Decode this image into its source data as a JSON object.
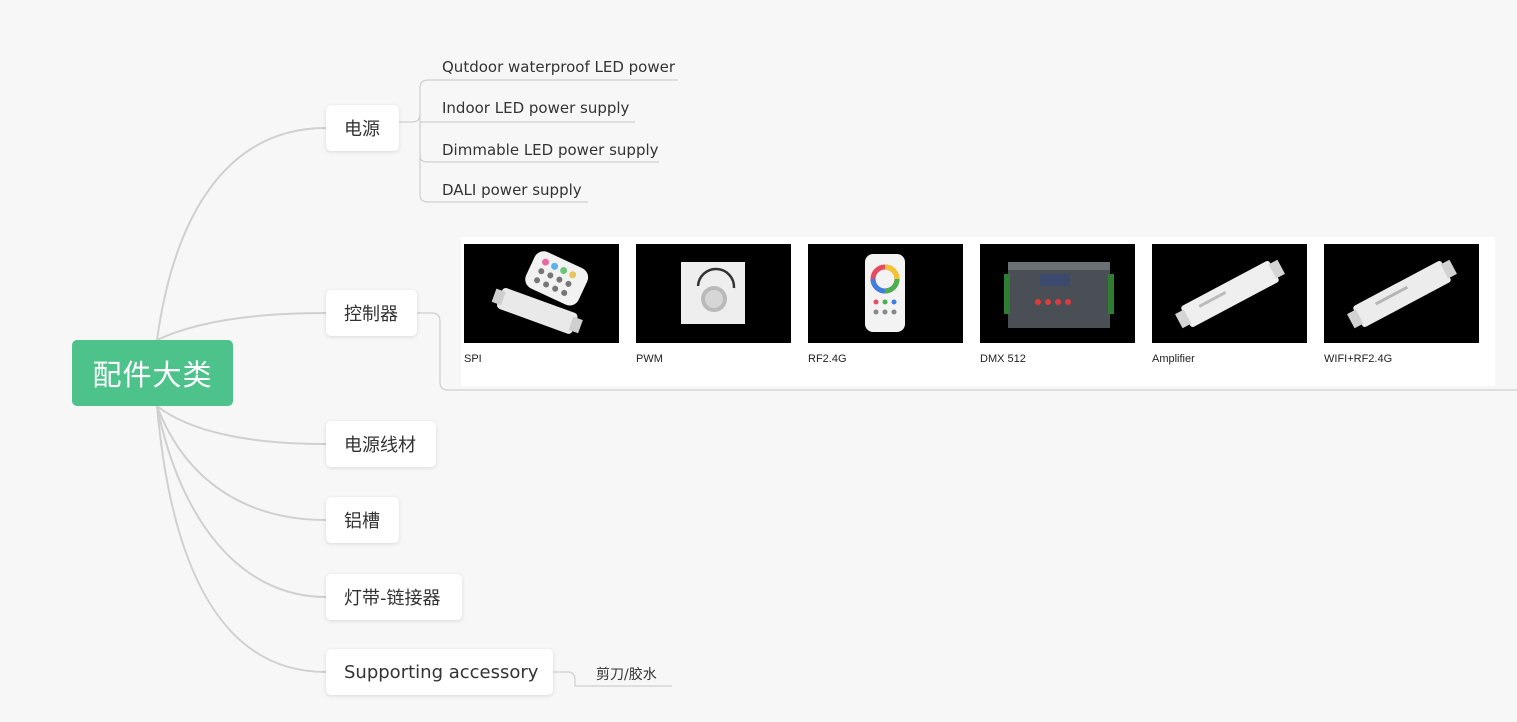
{
  "root": {
    "label": "配件大类"
  },
  "branches": [
    {
      "label": "电源"
    },
    {
      "label": "控制器"
    },
    {
      "label": "电源线材"
    },
    {
      "label": "铝槽"
    },
    {
      "label": "灯带-链接器"
    },
    {
      "label": "Supporting accessory"
    }
  ],
  "power_supply_items": [
    "Qutdoor waterproof LED power",
    "Indoor LED power supply",
    "Dimmable LED power supply",
    "DALI power supply"
  ],
  "controller_gallery": [
    {
      "label": "SPI",
      "image": "rf-remote-with-controller"
    },
    {
      "label": "PWM",
      "image": "rotary-dimmer-panel"
    },
    {
      "label": "RF2.4G",
      "image": "color-wheel-remote"
    },
    {
      "label": "DMX 512",
      "image": "dmx-controller-box"
    },
    {
      "label": "Amplifier",
      "image": "amplifier-module"
    },
    {
      "label": "WIFI+RF2.4G",
      "image": "wifi-controller-module"
    }
  ],
  "accessory_items": [
    "剪刀/胶水"
  ],
  "colors": {
    "background": "#f7f7f7",
    "root": "#4dc38b",
    "connector": "#d0d0d0",
    "node": "#ffffff",
    "text": "#333333"
  }
}
